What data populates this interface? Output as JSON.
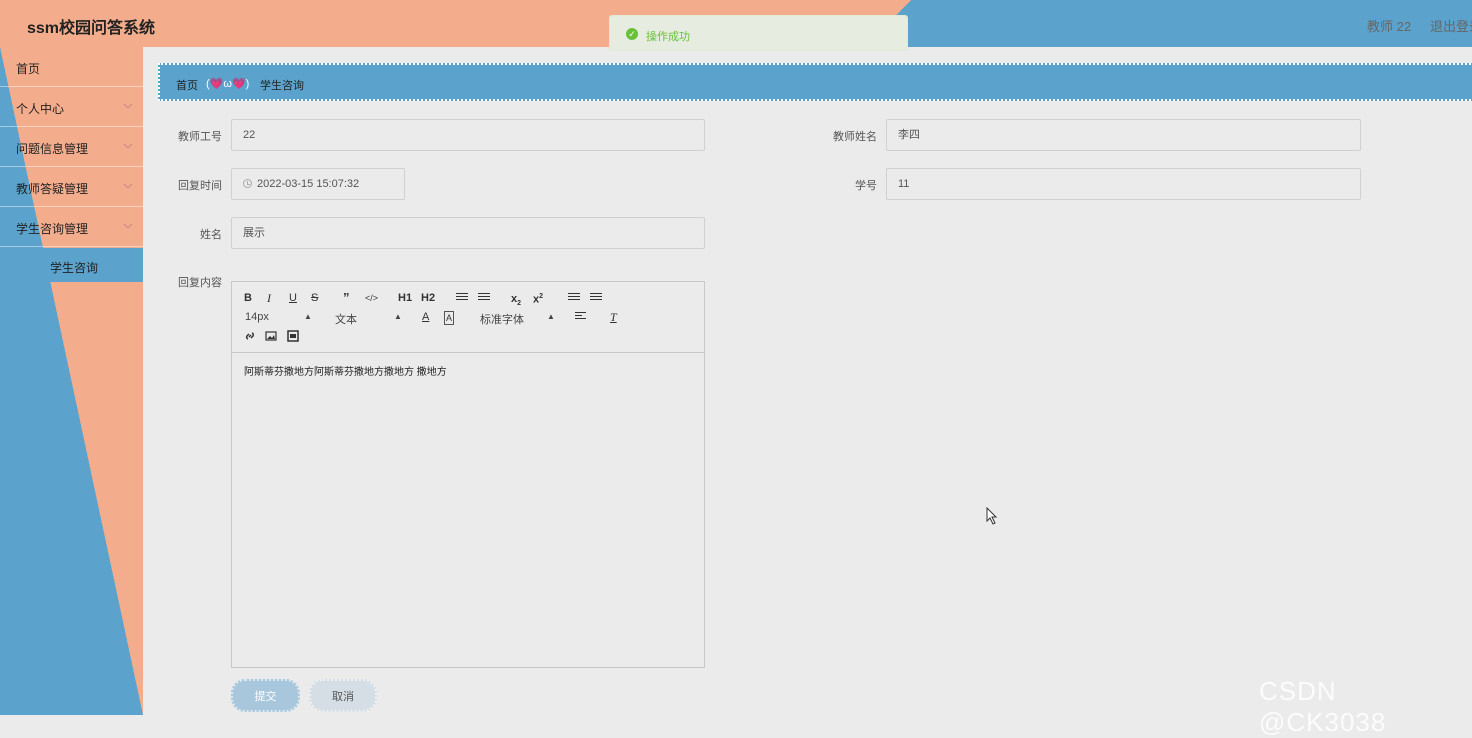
{
  "header": {
    "title": "ssm校园问答系统",
    "user": "教师 22",
    "logout": "退出登录"
  },
  "toast": {
    "message": "操作成功"
  },
  "sidebar": {
    "items": [
      {
        "label": "首页"
      },
      {
        "label": "个人中心"
      },
      {
        "label": "问题信息管理"
      },
      {
        "label": "教师答疑管理"
      },
      {
        "label": "学生咨询管理"
      }
    ],
    "active_sub": "学生咨询"
  },
  "breadcrumb": {
    "home": "首页",
    "separator": "(💗ω💗)",
    "current": "学生咨询"
  },
  "form": {
    "teacher_id": {
      "label": "教师工号",
      "value": "22"
    },
    "teacher_name": {
      "label": "教师姓名",
      "value": "李四"
    },
    "reply_time": {
      "label": "回复时间",
      "value": "2022-03-15 15:07:32"
    },
    "student_id": {
      "label": "学号",
      "value": "11"
    },
    "name": {
      "label": "姓名",
      "value": "展示"
    },
    "reply_content": {
      "label": "回复内容",
      "value": "阿斯蒂芬撒地方阿斯蒂芬撒地方撒地方 撒地方"
    }
  },
  "editor": {
    "font_size": "14px",
    "text_type": "文本",
    "font_family": "标准字体",
    "h1": "H1",
    "h2": "H2"
  },
  "buttons": {
    "submit": "提交",
    "cancel": "取消"
  },
  "watermark": "CSDN @CK3038"
}
